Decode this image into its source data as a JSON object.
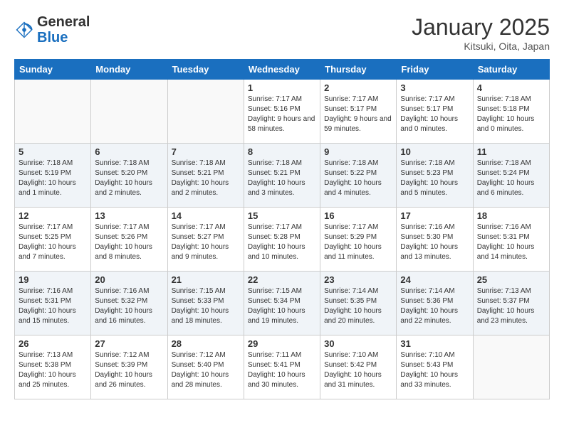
{
  "logo": {
    "general": "General",
    "blue": "Blue"
  },
  "header": {
    "title": "January 2025",
    "subtitle": "Kitsuki, Oita, Japan"
  },
  "weekdays": [
    "Sunday",
    "Monday",
    "Tuesday",
    "Wednesday",
    "Thursday",
    "Friday",
    "Saturday"
  ],
  "weeks": [
    [
      {
        "day": "",
        "sunrise": "",
        "sunset": "",
        "daylight": ""
      },
      {
        "day": "",
        "sunrise": "",
        "sunset": "",
        "daylight": ""
      },
      {
        "day": "",
        "sunrise": "",
        "sunset": "",
        "daylight": ""
      },
      {
        "day": "1",
        "sunrise": "Sunrise: 7:17 AM",
        "sunset": "Sunset: 5:16 PM",
        "daylight": "Daylight: 9 hours and 58 minutes."
      },
      {
        "day": "2",
        "sunrise": "Sunrise: 7:17 AM",
        "sunset": "Sunset: 5:17 PM",
        "daylight": "Daylight: 9 hours and 59 minutes."
      },
      {
        "day": "3",
        "sunrise": "Sunrise: 7:17 AM",
        "sunset": "Sunset: 5:17 PM",
        "daylight": "Daylight: 10 hours and 0 minutes."
      },
      {
        "day": "4",
        "sunrise": "Sunrise: 7:18 AM",
        "sunset": "Sunset: 5:18 PM",
        "daylight": "Daylight: 10 hours and 0 minutes."
      }
    ],
    [
      {
        "day": "5",
        "sunrise": "Sunrise: 7:18 AM",
        "sunset": "Sunset: 5:19 PM",
        "daylight": "Daylight: 10 hours and 1 minute."
      },
      {
        "day": "6",
        "sunrise": "Sunrise: 7:18 AM",
        "sunset": "Sunset: 5:20 PM",
        "daylight": "Daylight: 10 hours and 2 minutes."
      },
      {
        "day": "7",
        "sunrise": "Sunrise: 7:18 AM",
        "sunset": "Sunset: 5:21 PM",
        "daylight": "Daylight: 10 hours and 2 minutes."
      },
      {
        "day": "8",
        "sunrise": "Sunrise: 7:18 AM",
        "sunset": "Sunset: 5:21 PM",
        "daylight": "Daylight: 10 hours and 3 minutes."
      },
      {
        "day": "9",
        "sunrise": "Sunrise: 7:18 AM",
        "sunset": "Sunset: 5:22 PM",
        "daylight": "Daylight: 10 hours and 4 minutes."
      },
      {
        "day": "10",
        "sunrise": "Sunrise: 7:18 AM",
        "sunset": "Sunset: 5:23 PM",
        "daylight": "Daylight: 10 hours and 5 minutes."
      },
      {
        "day": "11",
        "sunrise": "Sunrise: 7:18 AM",
        "sunset": "Sunset: 5:24 PM",
        "daylight": "Daylight: 10 hours and 6 minutes."
      }
    ],
    [
      {
        "day": "12",
        "sunrise": "Sunrise: 7:17 AM",
        "sunset": "Sunset: 5:25 PM",
        "daylight": "Daylight: 10 hours and 7 minutes."
      },
      {
        "day": "13",
        "sunrise": "Sunrise: 7:17 AM",
        "sunset": "Sunset: 5:26 PM",
        "daylight": "Daylight: 10 hours and 8 minutes."
      },
      {
        "day": "14",
        "sunrise": "Sunrise: 7:17 AM",
        "sunset": "Sunset: 5:27 PM",
        "daylight": "Daylight: 10 hours and 9 minutes."
      },
      {
        "day": "15",
        "sunrise": "Sunrise: 7:17 AM",
        "sunset": "Sunset: 5:28 PM",
        "daylight": "Daylight: 10 hours and 10 minutes."
      },
      {
        "day": "16",
        "sunrise": "Sunrise: 7:17 AM",
        "sunset": "Sunset: 5:29 PM",
        "daylight": "Daylight: 10 hours and 11 minutes."
      },
      {
        "day": "17",
        "sunrise": "Sunrise: 7:16 AM",
        "sunset": "Sunset: 5:30 PM",
        "daylight": "Daylight: 10 hours and 13 minutes."
      },
      {
        "day": "18",
        "sunrise": "Sunrise: 7:16 AM",
        "sunset": "Sunset: 5:31 PM",
        "daylight": "Daylight: 10 hours and 14 minutes."
      }
    ],
    [
      {
        "day": "19",
        "sunrise": "Sunrise: 7:16 AM",
        "sunset": "Sunset: 5:31 PM",
        "daylight": "Daylight: 10 hours and 15 minutes."
      },
      {
        "day": "20",
        "sunrise": "Sunrise: 7:16 AM",
        "sunset": "Sunset: 5:32 PM",
        "daylight": "Daylight: 10 hours and 16 minutes."
      },
      {
        "day": "21",
        "sunrise": "Sunrise: 7:15 AM",
        "sunset": "Sunset: 5:33 PM",
        "daylight": "Daylight: 10 hours and 18 minutes."
      },
      {
        "day": "22",
        "sunrise": "Sunrise: 7:15 AM",
        "sunset": "Sunset: 5:34 PM",
        "daylight": "Daylight: 10 hours and 19 minutes."
      },
      {
        "day": "23",
        "sunrise": "Sunrise: 7:14 AM",
        "sunset": "Sunset: 5:35 PM",
        "daylight": "Daylight: 10 hours and 20 minutes."
      },
      {
        "day": "24",
        "sunrise": "Sunrise: 7:14 AM",
        "sunset": "Sunset: 5:36 PM",
        "daylight": "Daylight: 10 hours and 22 minutes."
      },
      {
        "day": "25",
        "sunrise": "Sunrise: 7:13 AM",
        "sunset": "Sunset: 5:37 PM",
        "daylight": "Daylight: 10 hours and 23 minutes."
      }
    ],
    [
      {
        "day": "26",
        "sunrise": "Sunrise: 7:13 AM",
        "sunset": "Sunset: 5:38 PM",
        "daylight": "Daylight: 10 hours and 25 minutes."
      },
      {
        "day": "27",
        "sunrise": "Sunrise: 7:12 AM",
        "sunset": "Sunset: 5:39 PM",
        "daylight": "Daylight: 10 hours and 26 minutes."
      },
      {
        "day": "28",
        "sunrise": "Sunrise: 7:12 AM",
        "sunset": "Sunset: 5:40 PM",
        "daylight": "Daylight: 10 hours and 28 minutes."
      },
      {
        "day": "29",
        "sunrise": "Sunrise: 7:11 AM",
        "sunset": "Sunset: 5:41 PM",
        "daylight": "Daylight: 10 hours and 30 minutes."
      },
      {
        "day": "30",
        "sunrise": "Sunrise: 7:10 AM",
        "sunset": "Sunset: 5:42 PM",
        "daylight": "Daylight: 10 hours and 31 minutes."
      },
      {
        "day": "31",
        "sunrise": "Sunrise: 7:10 AM",
        "sunset": "Sunset: 5:43 PM",
        "daylight": "Daylight: 10 hours and 33 minutes."
      },
      {
        "day": "",
        "sunrise": "",
        "sunset": "",
        "daylight": ""
      }
    ]
  ]
}
